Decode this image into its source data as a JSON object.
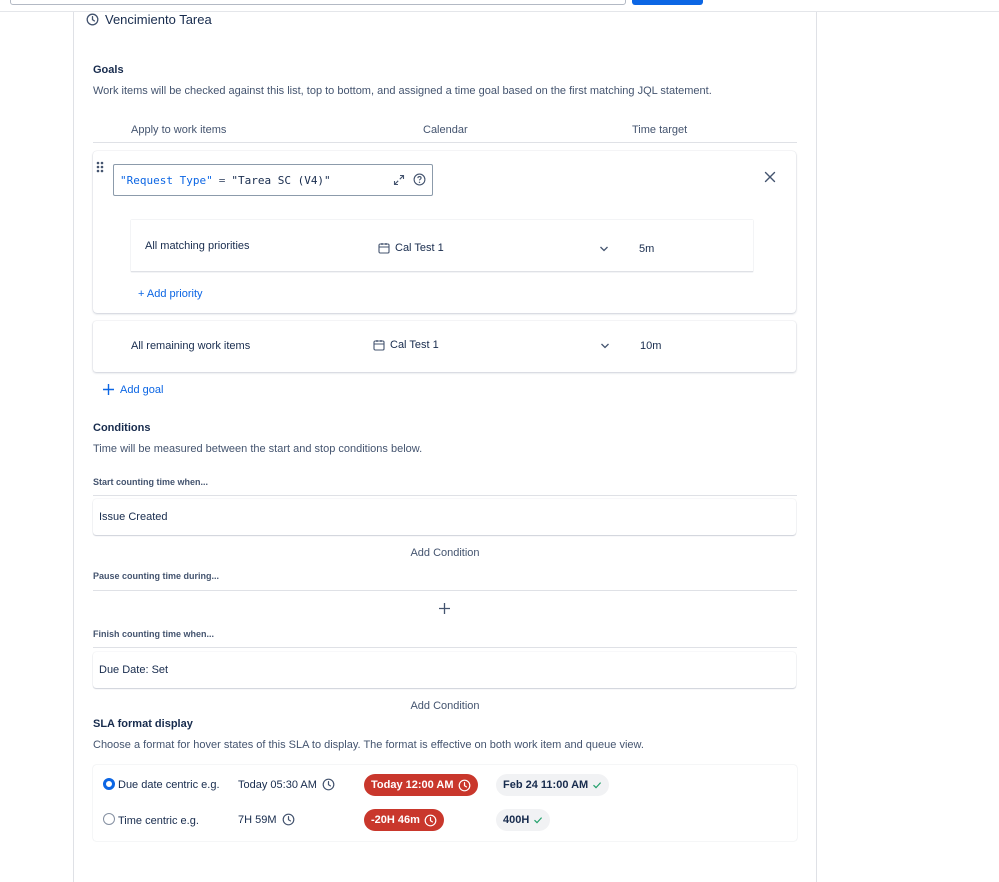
{
  "title": "Vencimiento Tarea",
  "goals": {
    "heading": "Goals",
    "description": "Work items will be checked against this list, top to bottom, and assigned a time goal based on the first matching JQL statement.",
    "columns": [
      "Apply to work items",
      "Calendar",
      "Time target"
    ],
    "goal": {
      "jql_key": "\"Request Type\"",
      "jql_op": "=",
      "jql_value": "\"Tarea SC (V4)\"",
      "priority_row": {
        "label": "All matching priorities",
        "calendar": "Cal Test 1",
        "target": "5m"
      },
      "add_priority": "+ Add priority"
    },
    "remaining": {
      "label": "All remaining work items",
      "calendar": "Cal Test 1",
      "target": "10m"
    },
    "add_goal": "Add goal"
  },
  "conditions": {
    "heading": "Conditions",
    "description": "Time will be measured between the start and stop conditions below.",
    "start_label": "Start counting time when...",
    "start_value": "Issue Created",
    "add_condition_1": "Add Condition",
    "pause_label": "Pause counting time during...",
    "finish_label": "Finish counting time when...",
    "finish_value": "Due Date: Set",
    "add_condition_2": "Add Condition"
  },
  "sla_format": {
    "heading": "SLA format display",
    "description": "Choose a format for hover states of this SLA to display. The format is effective on both work item and queue view.",
    "options": [
      {
        "label": "Due date centric e.g.",
        "selected": true,
        "plain": "Today 05:30 AM",
        "breached": "Today 12:00 AM",
        "met": "Feb 24 11:00 AM"
      },
      {
        "label": "Time centric e.g.",
        "selected": false,
        "plain": "7H 59M",
        "breached": "-20H 46m",
        "met": "400H"
      }
    ]
  },
  "colors": {
    "accent": "#0c66e4",
    "breached": "#c9372c",
    "met_bg": "#f1f2f4",
    "text": "#172b4d"
  }
}
